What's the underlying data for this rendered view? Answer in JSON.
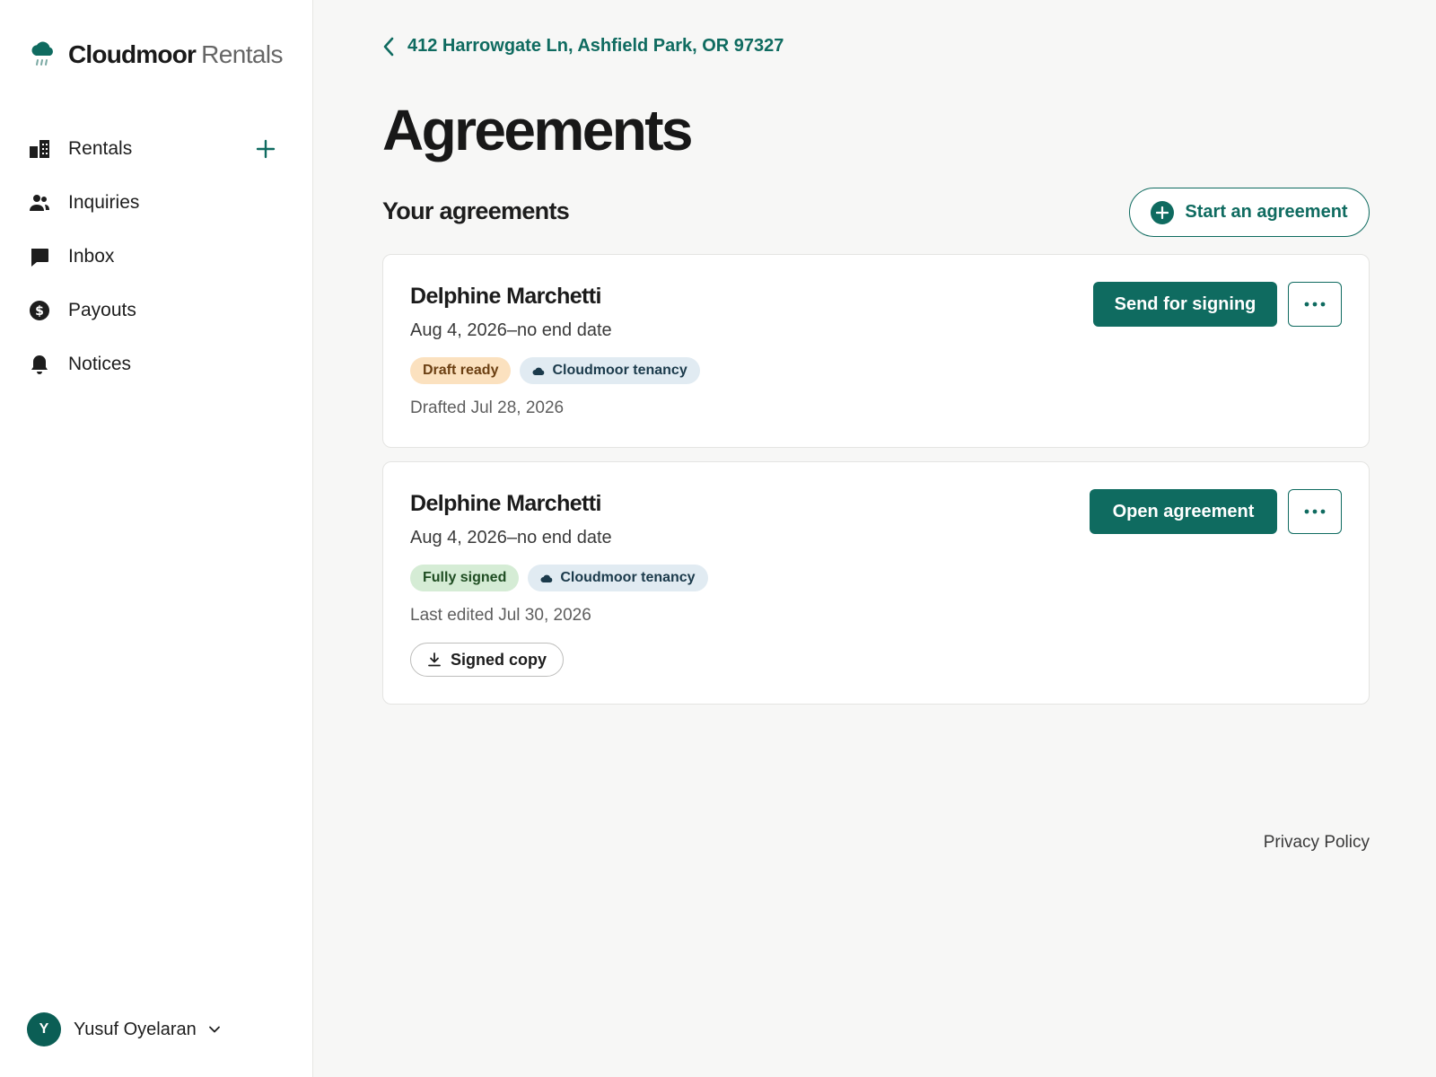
{
  "brand": {
    "name": "Cloudmoor",
    "suffix": "Rentals"
  },
  "sidebar": {
    "items": [
      {
        "label": "Rentals"
      },
      {
        "label": "Inquiries"
      },
      {
        "label": "Inbox"
      },
      {
        "label": "Payouts"
      },
      {
        "label": "Notices"
      }
    ]
  },
  "user": {
    "initial": "Y",
    "name": "Yusuf Oyelaran"
  },
  "breadcrumb": {
    "label": "412 Harrowgate Ln, Ashfield Park, OR 97327"
  },
  "page": {
    "title": "Agreements",
    "section_title": "Your agreements",
    "start_label": "Start an agreement"
  },
  "agreements": [
    {
      "name": "Delphine Marchetti",
      "dates": "Aug 4, 2026–no end date",
      "status": "Draft ready",
      "type": "Cloudmoor tenancy",
      "meta": "Drafted Jul 28, 2026",
      "action": "Send for signing"
    },
    {
      "name": "Delphine Marchetti",
      "dates": "Aug 4, 2026–no end date",
      "status": "Fully signed",
      "type": "Cloudmoor tenancy",
      "meta": "Last edited Jul 30, 2026",
      "action": "Open agreement",
      "download": "Signed copy"
    }
  ],
  "footer": {
    "privacy": "Privacy Policy"
  },
  "colors": {
    "accent": "#0f6b60",
    "draft_badge": "#fbe1bf",
    "signed_badge": "#d5ecd5",
    "tenancy_badge": "#e1ebf2"
  }
}
